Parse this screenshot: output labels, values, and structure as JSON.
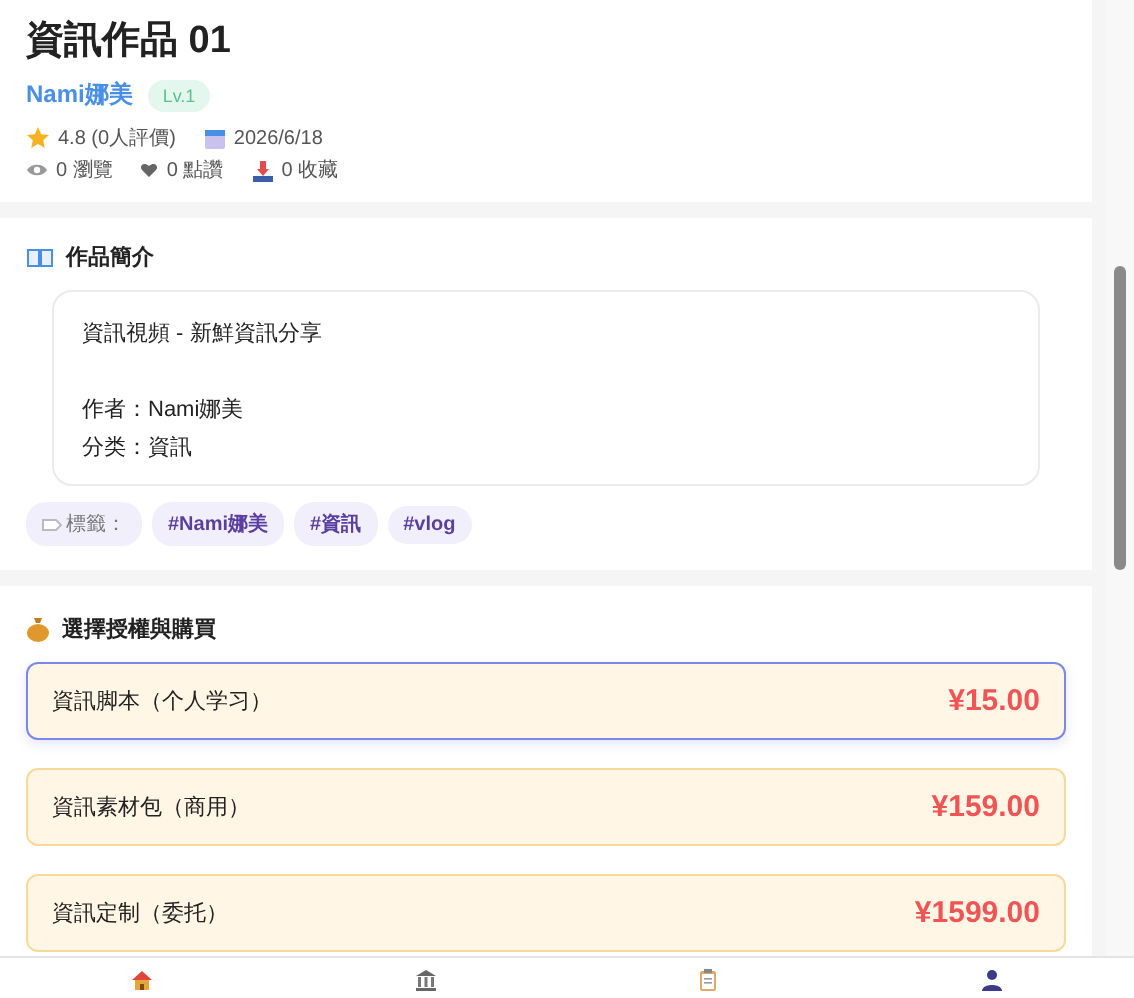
{
  "work": {
    "title": "資訊作品 01",
    "author": "Nami娜美",
    "level_badge": "Lv.1",
    "rating": "4.8 (0人評價)",
    "date": "2026/6/18",
    "views": "0 瀏覽",
    "likes": "0 點讚",
    "favorites": "0 收藏"
  },
  "intro": {
    "heading": "作品簡介",
    "paragraphs": [
      [
        "資訊視頻 - 新鮮資訊分享"
      ],
      [
        "作者：Nami娜美",
        "分类：資訊"
      ]
    ]
  },
  "tags": {
    "label": "標籤：",
    "items": [
      "#Nami娜美",
      "#資訊",
      "#vlog"
    ]
  },
  "purchase": {
    "heading": "選擇授權與購買",
    "options": [
      {
        "name": "資訊脚本（个人学习）",
        "price": "¥15.00",
        "selected": true
      },
      {
        "name": "資訊素材包（商用）",
        "price": "¥159.00",
        "selected": false
      },
      {
        "name": "資訊定制（委托）",
        "price": "¥1599.00",
        "selected": false
      }
    ]
  },
  "bottom_nav": [
    {
      "kind": "home"
    },
    {
      "kind": "bank"
    },
    {
      "kind": "clipboard"
    },
    {
      "kind": "person"
    }
  ]
}
